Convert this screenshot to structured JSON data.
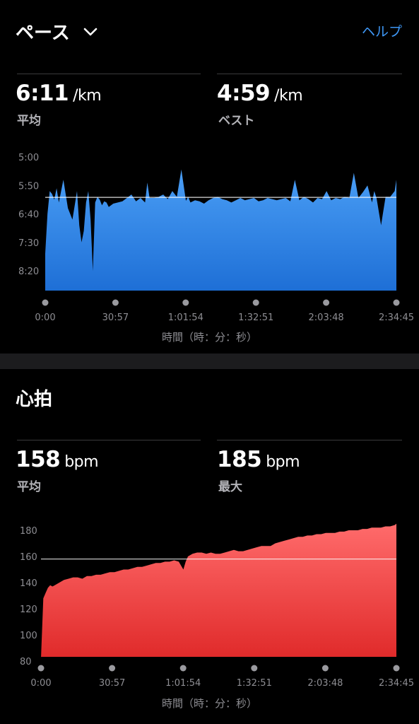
{
  "pace": {
    "title": "ペース",
    "help_label": "ヘルプ",
    "avg_value": "6:11",
    "avg_unit": "/km",
    "avg_label": "平均",
    "best_value": "4:59",
    "best_unit": "/km",
    "best_label": "ベスト",
    "x_axis_title": "時間（時：分：秒）",
    "color": "#3a8ef0"
  },
  "heart_rate": {
    "title": "心拍",
    "avg_value": "158",
    "avg_unit": "bpm",
    "avg_label": "平均",
    "max_value": "185",
    "max_unit": "bpm",
    "max_label": "最大",
    "x_axis_title": "時間（時：分：秒）",
    "color": "#f04040"
  },
  "chart_data": [
    {
      "type": "area",
      "title": "ペース",
      "xlabel": "時間（時：分：秒）",
      "ylabel": "",
      "x_ticks": [
        "0:00",
        "30:57",
        "1:01:54",
        "1:32:51",
        "2:03:48",
        "2:34:45"
      ],
      "y_ticks": [
        "5:00",
        "5:50",
        "6:40",
        "7:30",
        "8:20"
      ],
      "y_tick_seconds": [
        300,
        350,
        400,
        450,
        500
      ],
      "y_inverted": true,
      "ylim_seconds": [
        300,
        535
      ],
      "reference_line_seconds": 371,
      "x_minutes": [
        0,
        1,
        2,
        3,
        4,
        5,
        6,
        8,
        10,
        12,
        14,
        15,
        16,
        17,
        18,
        19,
        20,
        21,
        22,
        23,
        24,
        25,
        26,
        27,
        28,
        30,
        32,
        34,
        36,
        38,
        40,
        42,
        44,
        45,
        46,
        48,
        50,
        52,
        54,
        56,
        58,
        60,
        62,
        63,
        64,
        66,
        68,
        70,
        72,
        74,
        76,
        78,
        80,
        82,
        84,
        86,
        88,
        90,
        92,
        94,
        96,
        98,
        100,
        102,
        104,
        106,
        108,
        110,
        112,
        114,
        116,
        118,
        120,
        122,
        124,
        126,
        128,
        130,
        132,
        134,
        136,
        138,
        140,
        142,
        144,
        145,
        146,
        148,
        150,
        152,
        154,
        154.75
      ],
      "values_seconds": [
        470,
        400,
        360,
        365,
        375,
        355,
        380,
        340,
        390,
        410,
        360,
        420,
        450,
        430,
        380,
        360,
        410,
        500,
        380,
        370,
        375,
        385,
        378,
        380,
        388,
        382,
        380,
        378,
        372,
        366,
        378,
        372,
        380,
        345,
        372,
        372,
        370,
        366,
        374,
        360,
        370,
        322,
        377,
        370,
        380,
        376,
        378,
        382,
        376,
        372,
        370,
        374,
        376,
        380,
        376,
        372,
        376,
        374,
        372,
        378,
        376,
        372,
        374,
        376,
        374,
        372,
        378,
        340,
        376,
        370,
        374,
        380,
        372,
        374,
        360,
        376,
        372,
        374,
        370,
        372,
        328,
        372,
        362,
        350,
        380,
        360,
        372,
        420,
        370,
        370,
        360,
        340
      ]
    },
    {
      "type": "area",
      "title": "心拍",
      "xlabel": "時間（時：分：秒）",
      "ylabel": "",
      "x_ticks": [
        "0:00",
        "30:57",
        "1:01:54",
        "1:32:51",
        "2:03:48",
        "2:34:45"
      ],
      "y_ticks": [
        "180",
        "160",
        "140",
        "120",
        "100",
        "80"
      ],
      "ylim": [
        80,
        190
      ],
      "reference_line": 158,
      "x_minutes": [
        0,
        1,
        2,
        3,
        4,
        5,
        6,
        8,
        10,
        12,
        14,
        16,
        18,
        20,
        22,
        24,
        26,
        28,
        30,
        32,
        34,
        36,
        38,
        40,
        42,
        44,
        46,
        48,
        50,
        52,
        54,
        56,
        58,
        60,
        62,
        63,
        64,
        66,
        68,
        70,
        72,
        74,
        76,
        78,
        80,
        82,
        84,
        86,
        88,
        90,
        92,
        94,
        96,
        98,
        100,
        102,
        104,
        106,
        108,
        110,
        112,
        114,
        116,
        118,
        120,
        122,
        124,
        126,
        128,
        130,
        132,
        134,
        136,
        138,
        140,
        142,
        144,
        146,
        148,
        150,
        152,
        154,
        154.75
      ],
      "values": [
        82,
        128,
        132,
        136,
        138,
        137,
        138,
        140,
        142,
        143,
        144,
        144,
        143,
        145,
        145,
        146,
        146,
        147,
        148,
        148,
        149,
        150,
        150,
        151,
        152,
        152,
        153,
        154,
        155,
        155,
        156,
        156,
        157,
        156,
        150,
        156,
        160,
        162,
        163,
        163,
        162,
        163,
        162,
        162,
        163,
        164,
        165,
        164,
        164,
        165,
        166,
        167,
        168,
        168,
        168,
        170,
        171,
        172,
        173,
        174,
        175,
        175,
        176,
        176,
        177,
        177,
        178,
        178,
        178,
        179,
        179,
        180,
        180,
        180,
        181,
        181,
        182,
        182,
        182,
        183,
        183,
        184,
        185
      ]
    }
  ]
}
